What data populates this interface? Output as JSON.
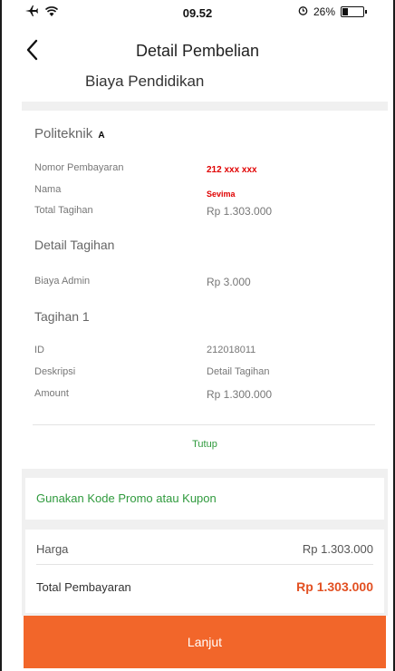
{
  "status": {
    "time": "09.52",
    "battery": "26%",
    "battery_level": 0.26
  },
  "header": {
    "title": "Detail Pembelian"
  },
  "section_label": "Biaya Pendidikan",
  "detail": {
    "school": "Politeknik",
    "school_suffix": "A",
    "nomor_label": "Nomor Pembayaran",
    "nomor_value": "212 xxx xxx",
    "nama_label": "Nama",
    "nama_value": "Sevima",
    "total_tagihan_label": "Total Tagihan",
    "total_tagihan_value": "Rp 1.303.000",
    "detail_tagihan_heading": "Detail Tagihan",
    "biaya_admin_label": "Biaya Admin",
    "biaya_admin_value": "Rp 3.000",
    "tagihan_heading": "Tagihan 1",
    "id_label": "ID",
    "id_value": "212018011",
    "deskripsi_label": "Deskripsi",
    "deskripsi_value": "Detail Tagihan",
    "amount_label": "Amount",
    "amount_value": "Rp 1.300.000",
    "tutup_label": "Tutup"
  },
  "promo": {
    "label": "Gunakan Kode Promo atau Kupon"
  },
  "summary": {
    "harga_label": "Harga",
    "harga_value": "Rp 1.303.000",
    "total_label": "Total Pembayaran",
    "total_value": "Rp 1.303.000"
  },
  "button": {
    "lanjut_label": "Lanjut"
  },
  "colors": {
    "accent_orange": "#f2662a",
    "green": "#2f9a3d",
    "red": "#e00000",
    "total_red": "#e25022"
  },
  "icons": {
    "back": "chevron-left-icon",
    "airplane": "airplane-icon",
    "wifi": "wifi-icon",
    "alarm": "alarm-icon",
    "battery": "battery-icon"
  }
}
